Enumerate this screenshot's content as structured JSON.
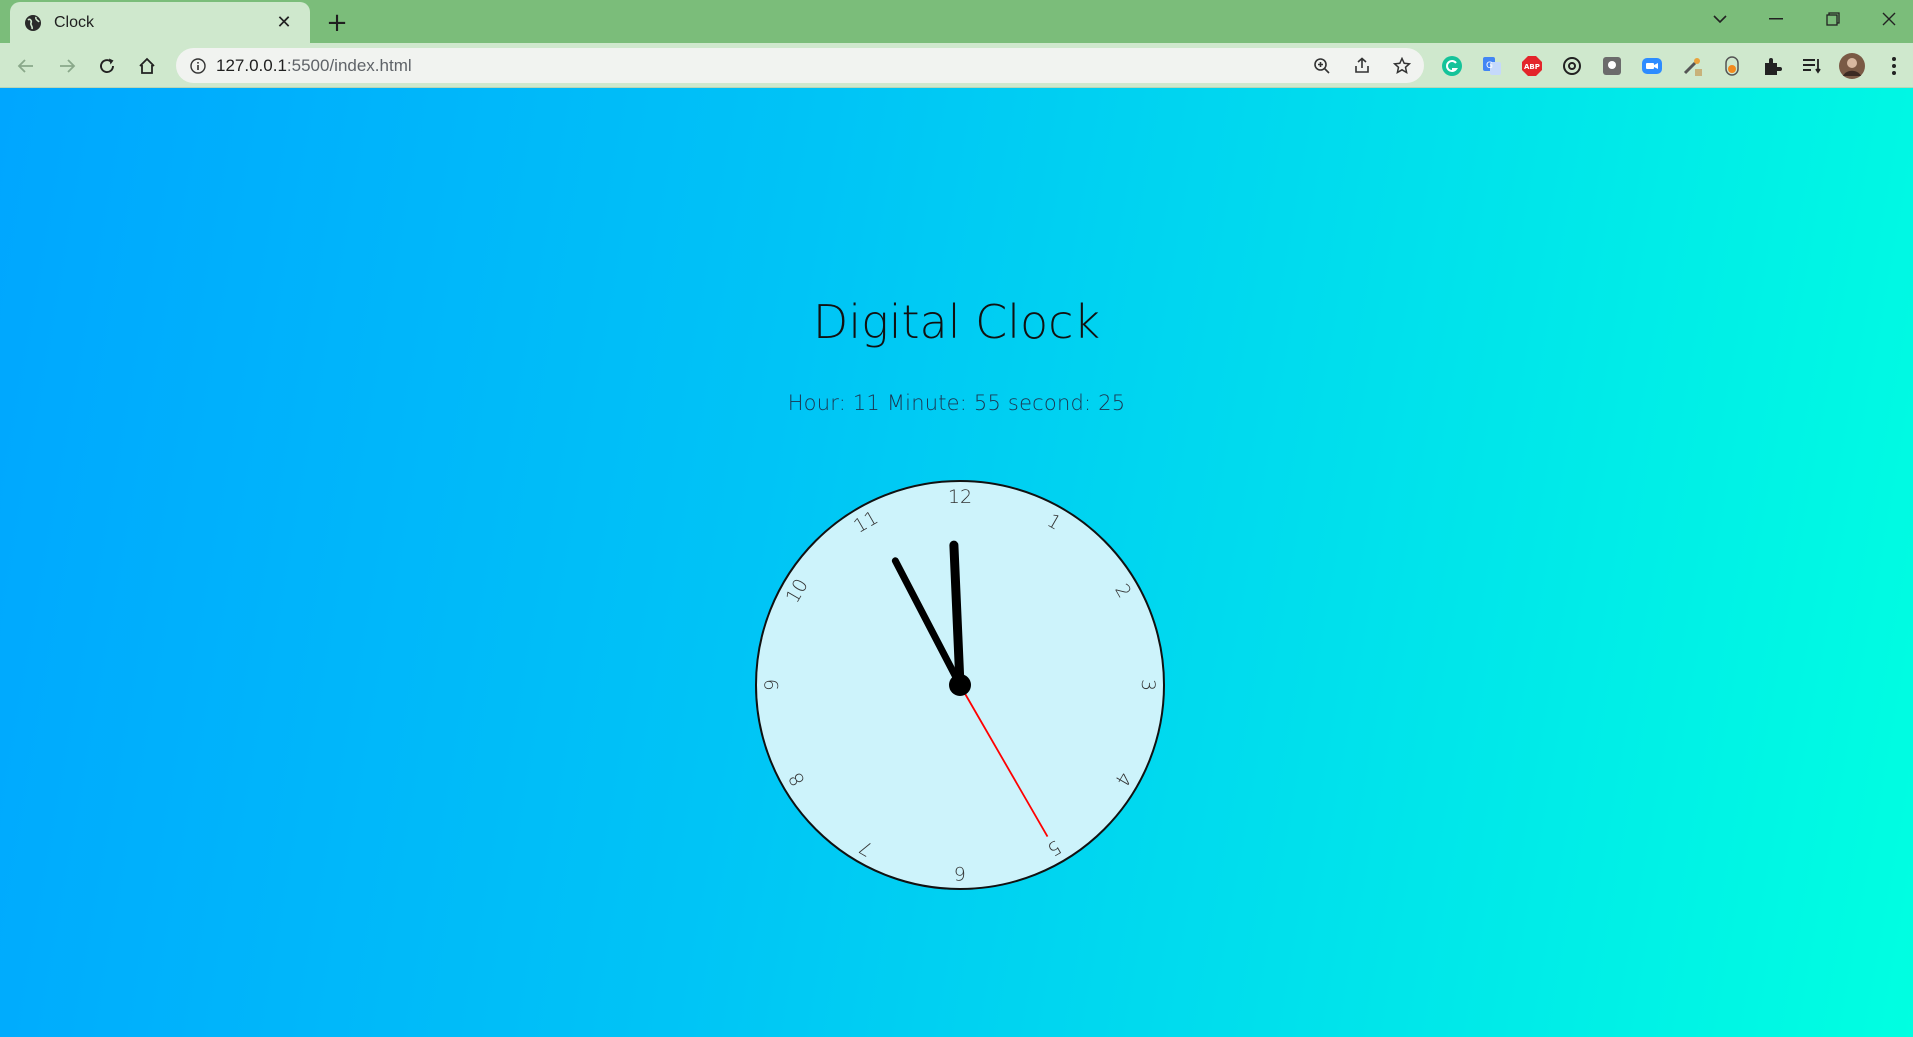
{
  "browser": {
    "tab": {
      "title": "Clock",
      "close_label": "✕",
      "new_tab_label": "+"
    },
    "url_host": "127.0.0.1",
    "url_rest": ":5500/index.html",
    "window_controls": {
      "tab_search": "⌄",
      "minimize": "—",
      "restore": "❐",
      "close": "✕"
    },
    "extensions": [
      "grammarly-icon",
      "translate-icon",
      "adblock-icon",
      "at-icon",
      "gray-box-icon",
      "zoom-ext-icon",
      "eyedropper-icon",
      "capture-icon",
      "puzzle-icon",
      "reading-list-icon",
      "profile-avatar"
    ],
    "colors": {
      "tabstrip": "#7bbd7a",
      "toolbar": "#cfe8cd"
    }
  },
  "page": {
    "title": "Digital Clock",
    "time_text": "Hour: 11 Minute: 55 second: 25",
    "colors": {
      "gradient_start": "#00a6ff",
      "gradient_end": "#00ffe1",
      "face": "#cdf3fb",
      "second_hand": "#ff0000"
    }
  },
  "clock": {
    "numbers": [
      "12",
      "1",
      "2",
      "3",
      "4",
      "5",
      "6",
      "7",
      "8",
      "9",
      "10",
      "11"
    ],
    "hour": 11,
    "minute": 55,
    "second": 25
  }
}
